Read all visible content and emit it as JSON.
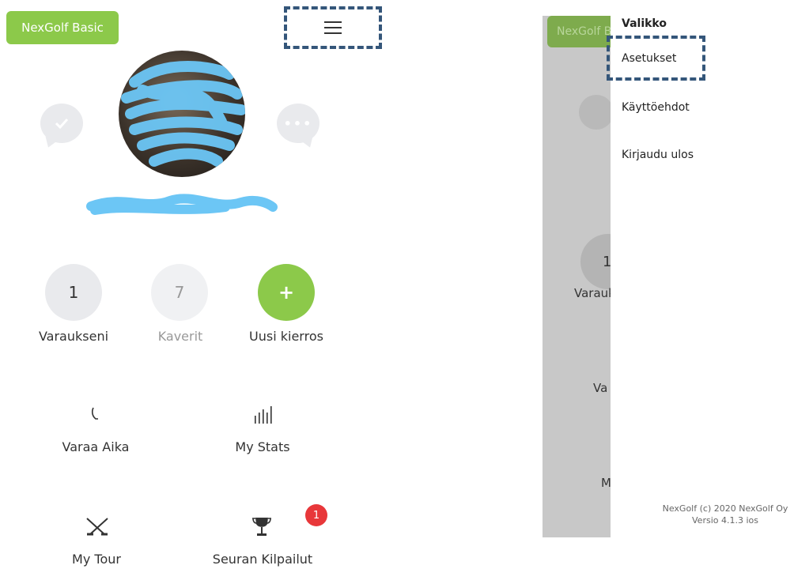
{
  "left": {
    "plan_badge": "NexGolf Basic",
    "stats": [
      {
        "value": "1",
        "label": "Varaukseni"
      },
      {
        "value": "7",
        "label": "Kaverit"
      },
      {
        "value": "+",
        "label": "Uusi kierros"
      }
    ],
    "menu": [
      {
        "icon": "phone-icon",
        "glyph": "⸝",
        "label": "Varaa Aika"
      },
      {
        "icon": "bar-stats-icon",
        "glyph": "ılıll",
        "label": "My Stats"
      },
      {
        "icon": "crossed-clubs-icon",
        "glyph": "✕",
        "label": "My Tour"
      },
      {
        "icon": "trophy-icon",
        "glyph": "♕",
        "label": "Seuran Kilpailut"
      }
    ],
    "notification_count": "1",
    "colors": {
      "brand_green": "#8cc94a",
      "highlight": "#34567a",
      "notification": "#e8373a"
    }
  },
  "right": {
    "background": {
      "badge_partial": "NexGolf B",
      "stat_partial": "1",
      "label_partial_1": "Varauk",
      "label_partial_2": "Va",
      "label_partial_3": "M"
    },
    "drawer": {
      "title": "Valikko",
      "items": [
        "Asetukset",
        "Käyttöehdot",
        "Kirjaudu ulos"
      ],
      "footer_line1": "NexGolf (c) 2020 NexGolf Oy",
      "footer_line2": "Versio 4.1.3 ios"
    }
  }
}
